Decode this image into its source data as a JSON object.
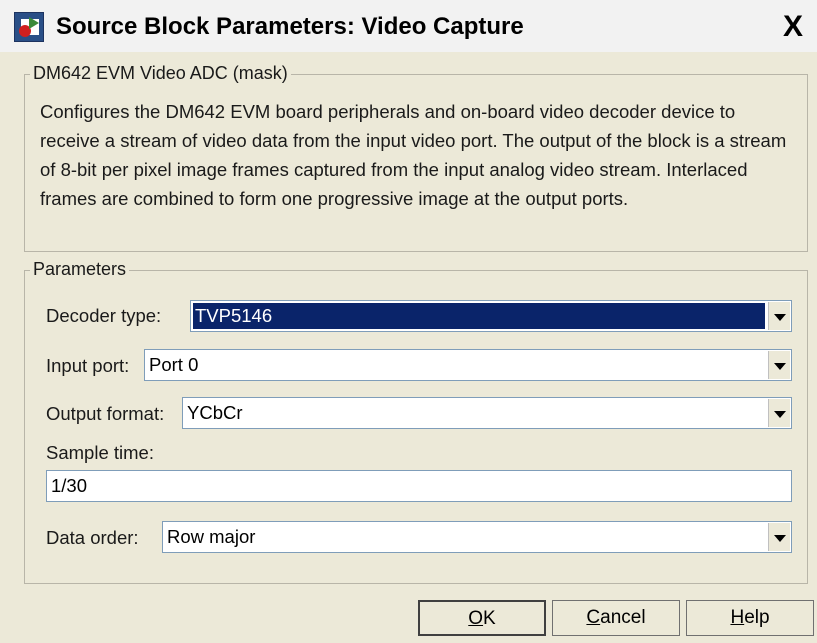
{
  "window": {
    "title": "Source Block Parameters: Video Capture",
    "close_glyph": "X"
  },
  "mask_group": {
    "label": "DM642 EVM Video ADC (mask)",
    "description": "Configures the DM642 EVM board peripherals and on-board video decoder device to receive a stream of video data from the input video port. The output of the block is a stream of 8-bit per pixel  image frames captured from the input analog video stream. Interlaced frames are combined to form one progressive image at the output ports."
  },
  "parameters_group": {
    "label": "Parameters",
    "decoder_type": {
      "label": "Decoder type:",
      "value": "TVP5146"
    },
    "input_port": {
      "label": "Input port:",
      "value": "Port 0"
    },
    "output_format": {
      "label": "Output format:",
      "value": "YCbCr"
    },
    "sample_time": {
      "label": "Sample time:",
      "value": "1/30"
    },
    "data_order": {
      "label": "Data order:",
      "value": "Row major"
    }
  },
  "buttons": {
    "ok": {
      "mnemonic": "O",
      "rest": "K"
    },
    "cancel": {
      "mnemonic": "C",
      "rest": "ancel"
    },
    "help": {
      "mnemonic": "H",
      "rest": "elp"
    }
  },
  "icons": {
    "app_icon": "simulink-block-icon",
    "dropdown_icon": "chevron-down-icon"
  }
}
